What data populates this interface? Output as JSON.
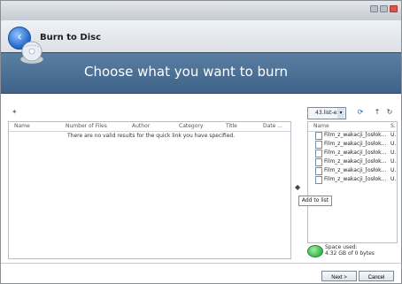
{
  "window": {
    "title": "Burn to Disc",
    "controls": [
      "minimize-icon",
      "maximize-icon",
      "close-icon"
    ]
  },
  "header": {
    "banner_title": "Choose what you want to burn"
  },
  "left_list": {
    "columns": [
      "Name",
      "Number of Files",
      "Author",
      "Category",
      "Title",
      "Date ..."
    ],
    "empty_message": "There are no valid results for the quick link you have specified."
  },
  "right_panel": {
    "dropdown_value": "43.list-ex",
    "header": [
      "Name",
      "S."
    ],
    "files": [
      {
        "name": "Film_z_wakacji_[osłok...",
        "flag": "U."
      },
      {
        "name": "Film_z_wakacji_[osłok...",
        "flag": "U."
      },
      {
        "name": "Film_z_wakacji_[osłok...",
        "flag": "U."
      },
      {
        "name": "Film_z_wakacji_[osłok...",
        "flag": "U."
      },
      {
        "name": "Film_z_wakacji_[osłok...",
        "flag": "U."
      },
      {
        "name": "Film_z_wakacji_[osłok...",
        "flag": "U."
      }
    ]
  },
  "tooltip": {
    "text": "Add to list"
  },
  "space": {
    "label": "Space used:",
    "value": "4.32 GB of 0 bytes"
  },
  "footer": {
    "next": "Next >",
    "cancel": "Cancel"
  }
}
